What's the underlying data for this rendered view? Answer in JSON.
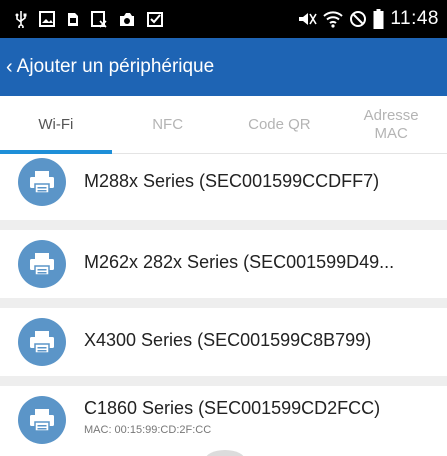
{
  "status_bar": {
    "time": "11:48",
    "left_icons": [
      "usb-icon",
      "gallery-icon",
      "sim-icon",
      "nfc-card-icon",
      "camera-icon",
      "clipboard-check-icon"
    ],
    "right_icons": [
      "mute-icon",
      "wifi-icon",
      "blocked-icon",
      "battery-icon"
    ]
  },
  "app_bar": {
    "back_glyph": "‹",
    "title": "Ajouter un périphérique",
    "color": "#1e64b4"
  },
  "tabs": [
    {
      "label": "Wi-Fi",
      "active": true
    },
    {
      "label": "NFC",
      "active": false
    },
    {
      "label": "Code QR",
      "active": false
    },
    {
      "label_line1": "Adresse",
      "label_line2": "MAC",
      "active": false
    }
  ],
  "devices": [
    {
      "name": "M288x Series (SEC001599CCDFF7)",
      "icon": "printer-icon"
    },
    {
      "name": "M262x 282x Series (SEC001599D49...",
      "icon": "printer-icon"
    },
    {
      "name": "X4300 Series (SEC001599C8B799)",
      "icon": "printer-icon"
    },
    {
      "name": "C1860 Series (SEC001599CD2FCC)",
      "mac": "MAC: 00:15:99:CD:2F:CC",
      "icon": "printer-icon"
    }
  ],
  "colors": {
    "accent_tab": "#1e8fd8",
    "avatar": "#5b95c8"
  }
}
